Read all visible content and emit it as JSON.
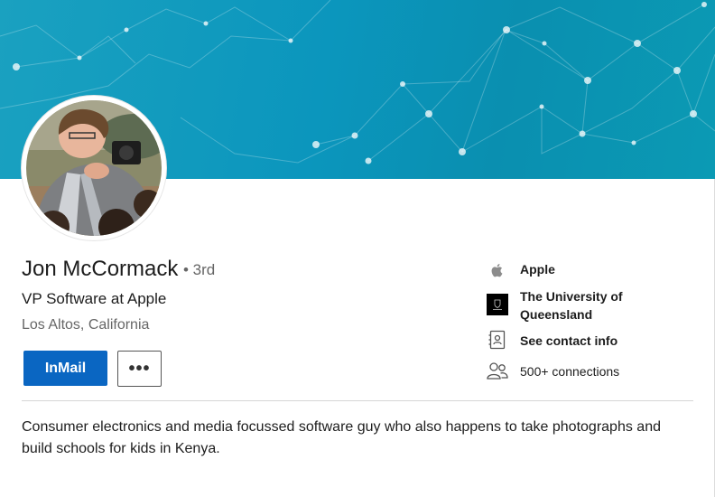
{
  "profile": {
    "name": "Jon McCormack",
    "degree": "• 3rd",
    "headline": "VP Software at Apple",
    "location": "Los Altos, California"
  },
  "actions": {
    "inmail_label": "InMail",
    "more_label": "•••"
  },
  "sidebar": {
    "company": {
      "icon": "apple-logo-icon",
      "label": "Apple"
    },
    "school": {
      "icon": "university-logo-icon",
      "label_line1": "The University of",
      "label_line2": "Queensland"
    },
    "contact": {
      "icon": "contact-card-icon",
      "label": "See contact info"
    },
    "connections": {
      "icon": "people-icon",
      "label": "500+ connections"
    }
  },
  "about": {
    "text": "Consumer electronics and media focussed software guy who also happens to take photographs and build schools for kids in Kenya."
  },
  "colors": {
    "banner": "#0b96bd",
    "primary_button": "#0a66c2"
  }
}
